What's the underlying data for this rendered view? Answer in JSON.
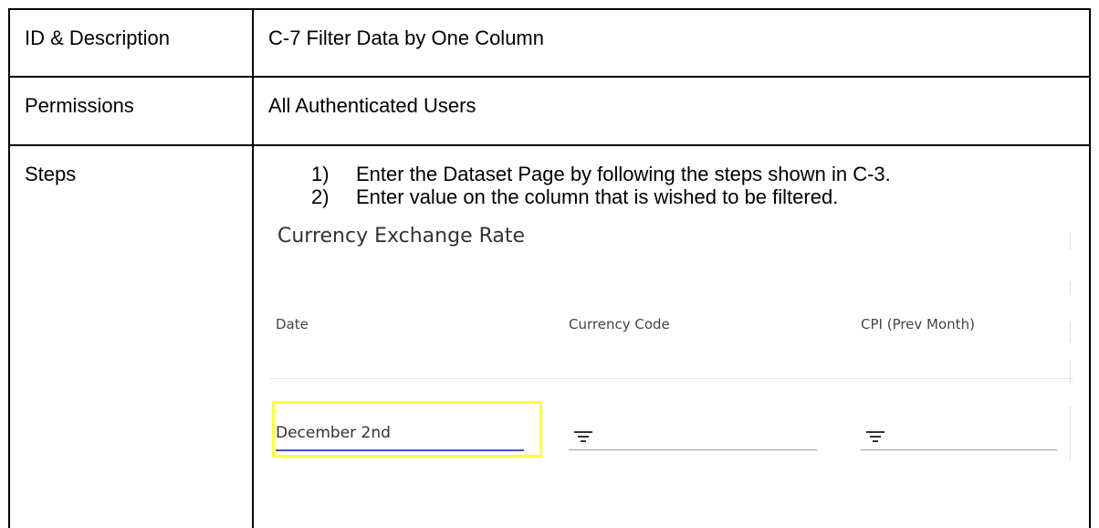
{
  "table": {
    "rows": [
      {
        "label": "ID & Description",
        "value": "C-7 Filter Data by One Column"
      },
      {
        "label": "Permissions",
        "value": "All Authenticated Users"
      },
      {
        "label": "Steps"
      }
    ],
    "steps": [
      {
        "num": "1)",
        "text": "Enter the Dataset Page by following the steps shown in C-3."
      },
      {
        "num": "2)",
        "text": "Enter value on the column that is wished to be filtered."
      }
    ]
  },
  "embedded_ui": {
    "title": "Currency Exchange Rate",
    "columns": [
      {
        "header": "Date",
        "filter_value": "December 2nd",
        "filter_icon": "filter-icon"
      },
      {
        "header": "Currency Code",
        "filter_value": "",
        "filter_icon": "filter-icon"
      },
      {
        "header": "CPI (Prev Month)",
        "filter_value": "",
        "filter_icon": "filter-icon"
      }
    ],
    "colors": {
      "active_underline": "#3f51b5",
      "highlight_border": "#ffff33"
    }
  }
}
